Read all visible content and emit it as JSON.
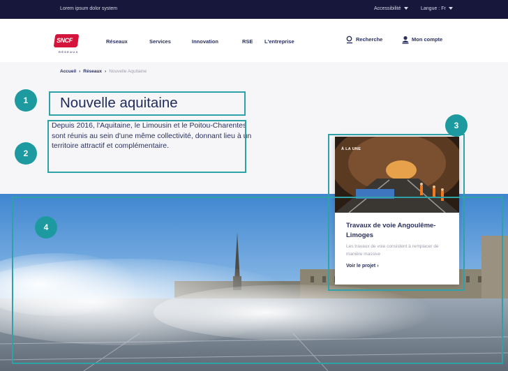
{
  "topbar": {
    "lorem": "Lorem ipsum dolor system",
    "accessibility": "Accessibilité",
    "language": "Langue : Fr"
  },
  "logo": {
    "brand": "SNCF",
    "sub": "RÉSEAUX"
  },
  "nav": {
    "items": [
      "Réseaux",
      "Services",
      "Innovation",
      "RSE",
      "L'entreprise"
    ],
    "search": "Recherche",
    "account": "Mon compte"
  },
  "breadcrumb": [
    "Accueil",
    "Réseaux",
    "Nouvelle Aquitaine"
  ],
  "page": {
    "title": "Nouvelle aquitaine",
    "intro": "Depuis 2016, l'Aquitaine, le Limousin et le Poitou-Charentes sont réunis au sein d'une même collectivité, donnant lieu à un territoire attractif et complémentaire."
  },
  "card": {
    "badge": "À LA UNE",
    "title": "Travaux de voie Angoulême-Limoges",
    "text": "Les travaux de voie consistent à remplacer de manière massive",
    "link": "Voir le projet"
  },
  "annotations": [
    "1",
    "2",
    "3",
    "4"
  ],
  "colors": {
    "topbar": "#16173a",
    "navy_text": "#1f2a5a",
    "sncf_red": "#d4143a",
    "annotation_teal": "#1d9aa0"
  },
  "icons": [
    "search-icon",
    "user-icon",
    "chevron-down-icon",
    "chevron-right-icon"
  ]
}
